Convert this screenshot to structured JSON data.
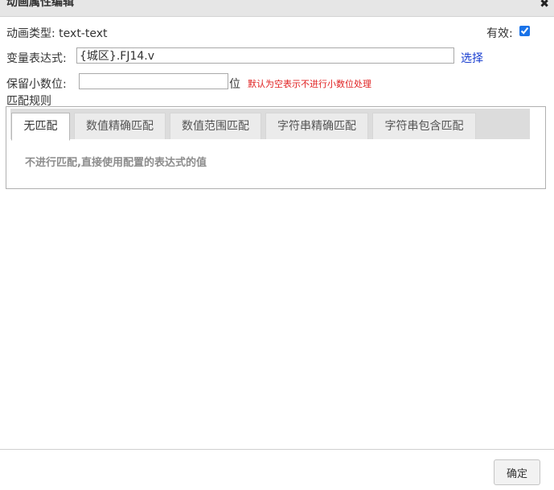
{
  "dialog": {
    "title": "动画属性编辑",
    "close_glyph": "✖"
  },
  "form": {
    "anim_type_label": "动画类型:",
    "anim_type_value": "text-text",
    "valid_label": "有效:",
    "valid_checked": true,
    "expr_label": "变量表达式:",
    "expr_value": "{城区}.FJ14.v",
    "select_link": "选择",
    "decimal_label": "保留小数位:",
    "decimal_value": "",
    "decimal_unit": "位",
    "decimal_hint": "默认为空表示不进行小数位处理"
  },
  "match": {
    "label": "匹配规则",
    "tabs": [
      {
        "label": "无匹配",
        "active": true
      },
      {
        "label": "数值精确匹配",
        "active": false
      },
      {
        "label": "数值范围匹配",
        "active": false
      },
      {
        "label": "字符串精确匹配",
        "active": false
      },
      {
        "label": "字符串包含匹配",
        "active": false
      }
    ],
    "description": "不进行匹配,直接使用配置的表达式的值"
  },
  "footer": {
    "ok_label": "确定"
  }
}
